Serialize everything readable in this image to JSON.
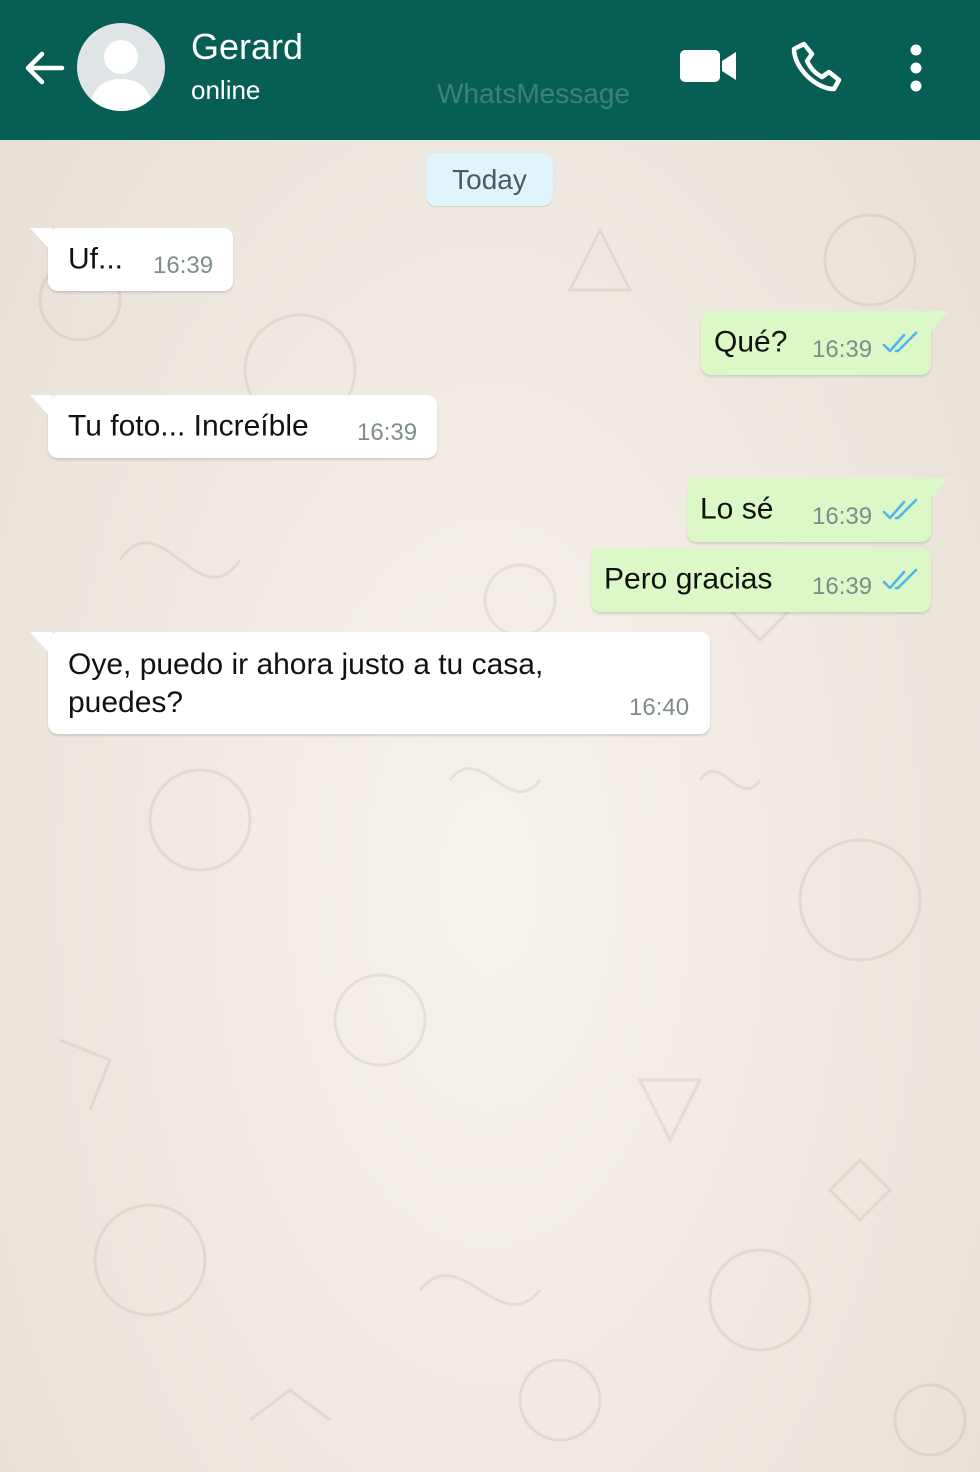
{
  "header": {
    "contact_name": "Gerard",
    "status": "online",
    "watermark": "WhatsMessage",
    "background_color": "#075e54"
  },
  "chat": {
    "date_separator": "Today",
    "messages": [
      {
        "direction": "incoming",
        "text": "Uf...",
        "time": "16:39"
      },
      {
        "direction": "outgoing",
        "text": "Qué?",
        "time": "16:39",
        "read_receipt": "double-check-blue"
      },
      {
        "direction": "incoming",
        "text": "Tu foto... Increíble",
        "time": "16:39"
      },
      {
        "direction": "outgoing",
        "text": "Lo sé",
        "time": "16:39",
        "read_receipt": "double-check-blue"
      },
      {
        "direction": "outgoing",
        "text": "Pero gracias",
        "time": "16:39",
        "read_receipt": "double-check-blue"
      },
      {
        "direction": "incoming",
        "text_line1": "Oye, puedo ir ahora justo a tu casa,",
        "text_line2": "puedes?",
        "time": "16:40"
      }
    ]
  },
  "colors": {
    "incoming_bubble": "#ffffff",
    "outgoing_bubble": "#dcf8c6",
    "read_tick": "#4fb6ec"
  },
  "icons": [
    "back-arrow-icon",
    "avatar-icon",
    "video-call-icon",
    "phone-call-icon",
    "more-options-icon",
    "double-check-icon"
  ]
}
